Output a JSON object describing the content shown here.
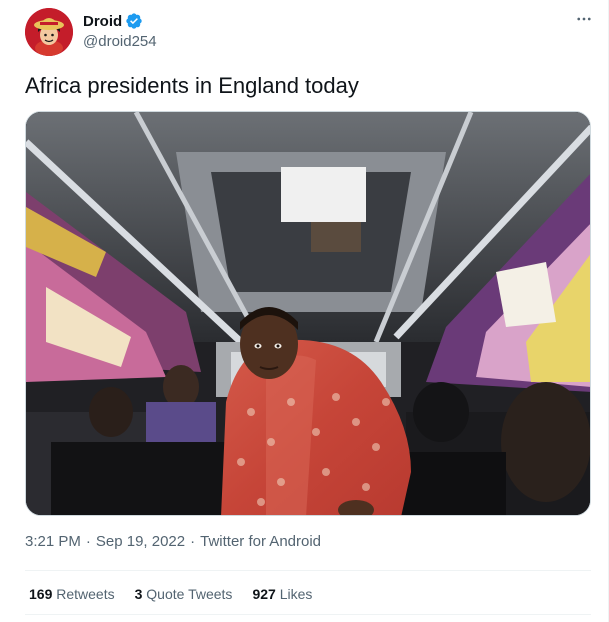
{
  "tweet": {
    "author": {
      "display_name": "Droid",
      "handle": "@droid254",
      "verified_icon": "verified-badge-icon",
      "avatar_icon": "anime-avatar"
    },
    "more_icon": "more-options-icon",
    "text": "Africa presidents in England today",
    "media": {
      "description_icon": "bus-interior-photo"
    },
    "meta": {
      "time": "3:21 PM",
      "date": "Sep 19, 2022",
      "source": "Twitter for Android",
      "separator": "·"
    },
    "stats": {
      "retweets_count": "169",
      "retweets_label": "Retweets",
      "quotes_count": "3",
      "quotes_label": "Quote Tweets",
      "likes_count": "927",
      "likes_label": "Likes"
    }
  },
  "colors": {
    "text_primary": "#0f1419",
    "text_secondary": "#536471",
    "verified_blue": "#1d9bf0",
    "divider": "#eff3f4"
  }
}
